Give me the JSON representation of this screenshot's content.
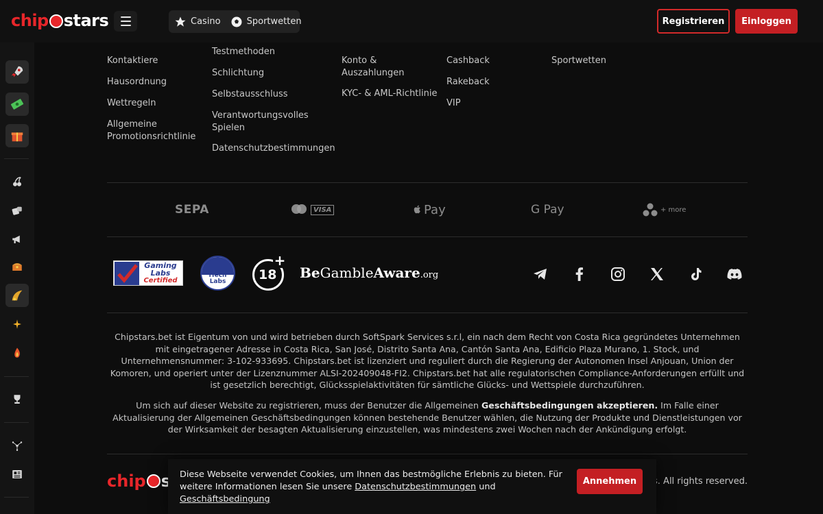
{
  "header": {
    "logo_chip": "chip",
    "logo_stars": "stars",
    "nav": [
      {
        "label": "Casino",
        "icon": "star-icon"
      },
      {
        "label": "Sportwetten",
        "icon": "soccer-ball-icon"
      }
    ],
    "register_label": "Registrieren",
    "login_label": "Einloggen"
  },
  "sidebar": {
    "items": [
      {
        "icon": "rocket-icon"
      },
      {
        "icon": "money-icon"
      },
      {
        "icon": "gift-icon"
      },
      {
        "icon": "cherry-icon"
      },
      {
        "icon": "dice-icon"
      },
      {
        "icon": "megaphone-icon"
      },
      {
        "icon": "treasure-chest-icon"
      },
      {
        "icon": "golden-horn-icon"
      },
      {
        "icon": "spark-icon"
      },
      {
        "icon": "fire-icon"
      },
      {
        "icon": "trophy-icon"
      },
      {
        "icon": "network-icon"
      },
      {
        "icon": "news-icon"
      }
    ]
  },
  "footer": {
    "col1": [
      "Kontaktiere",
      "Hausordnung",
      "Wettregeln",
      "Allgemeine Promotionsrichtlinie"
    ],
    "col2": [
      "Testmethoden",
      "Schlichtung",
      "Selbstausschluss",
      "Verantwortungsvolles Spielen",
      "Datenschutzbestimmungen"
    ],
    "col3": [
      "Konto & Auszahlungen",
      "KYC- & AML-Richtlinie"
    ],
    "col4": [
      "Cashback",
      "Rakeback",
      "VIP"
    ],
    "col5": [
      "Sportwetten"
    ],
    "payments": [
      "SEPA",
      "Mastercard",
      "VISA",
      "Pay",
      "G Pay",
      "+ more"
    ],
    "badges": {
      "gaming_labs_1": "Gaming",
      "gaming_labs_2": "Labs",
      "gaming_labs_3": "Certified",
      "itech_1": "iTech",
      "itech_2": "Labs",
      "age": "18",
      "gamble_aware_be": "Be",
      "gamble_aware_gamble": "Gamble",
      "gamble_aware_aware": "Aware",
      "gamble_aware_org": ".org"
    },
    "social": [
      "telegram-icon",
      "facebook-icon",
      "instagram-icon",
      "x-icon",
      "tiktok-icon",
      "discord-icon"
    ],
    "legal1": "Chipstars.bet ist Eigentum von und wird betrieben durch SoftSpark Services s.r.l, ein nach dem Recht von Costa Rica gegründetes Unternehmen mit eingetragener Adresse in Costa Rica, San José, Distrito Santa Ana, Cantón Santa Ana, Edificio Plaza Murano, 1. Stock, und Unternehmensnummer: 3-102-933695. Chipstars.bet ist lizenziert und reguliert durch die Regierung der Autonomen Insel Anjouan, Union der Komoren, und operiert unter der Lizenznummer ALSI-202409048-FI2. Chipstars.bet hat alle regulatorischen Compliance-Anforderungen erfüllt und ist gesetzlich berechtigt, Glücksspielaktivitäten für sämtliche Glücks- und Wettspiele durchzuführen.",
    "legal2_a": "Um sich auf dieser Website zu registrieren, muss der Benutzer die Allgemeinen ",
    "legal2_b": "Geschäftsbedingungen akzeptieren.",
    "legal2_c": " Im Falle einer Aktualisierung der Allgemeinen Geschäftsbedingungen können bestehende Benutzer wählen, die Nutzung der Produkte und Dienstleistungen vor der Wirksamkeit der besagten Aktualisierung einzustellen, was mindestens zwei Wochen nach der Ankündigung erfolgt.",
    "rights": "stars. All rights reserved."
  },
  "cookie": {
    "text_a": "Diese Webseite verwendet Cookies, um Ihnen das bestmögliche Erlebnis zu bieten. Für weitere Informationen lesen Sie unsere ",
    "link1": "Datenschutzbestimmungen",
    "text_b": " und ",
    "link2": "Geschäftsbedingung",
    "accept_label": "Annehmen"
  },
  "colors": {
    "accent": "#c41f23",
    "background": "#0d0d0d",
    "sidebar": "#141414"
  }
}
